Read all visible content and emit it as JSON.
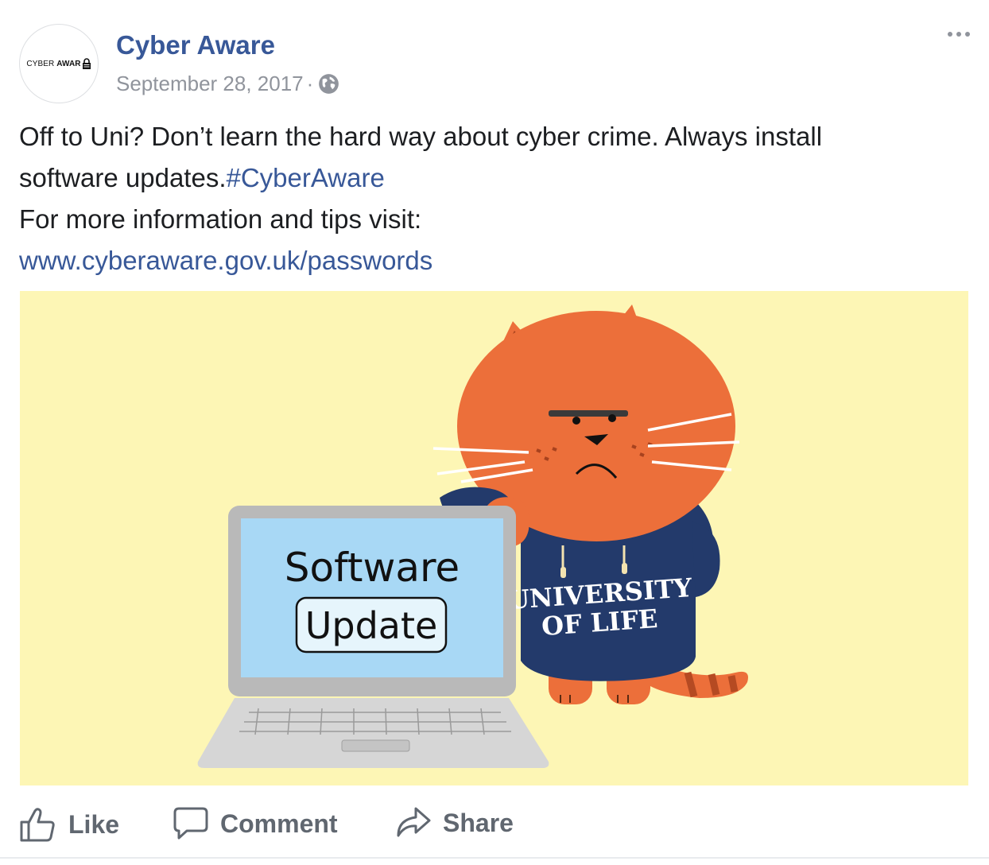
{
  "post": {
    "avatar_text_1": "CYBER",
    "avatar_text_2": "AWAR",
    "page_name": "Cyber Aware",
    "date": "September 28, 2017",
    "separator": "·",
    "privacy_icon": "globe-icon",
    "text_line1": "Off to Uni? Don’t learn the hard way about cyber crime. Always install",
    "text_line2_prefix": "software updates.",
    "hashtag": "#CyberAware",
    "text_line3": "For more information and tips visit:",
    "link": "www.cyberaware.gov.uk/passwords"
  },
  "image": {
    "screen_line1": "Software",
    "screen_line2": "Update",
    "hoodie_line1": "UNIVERSITY",
    "hoodie_line2": "OF LIFE",
    "background_color": "#fdf6b5",
    "cat_color": "#ec6f3a",
    "hoodie_color": "#233a6b",
    "screen_color": "#a8d8f5"
  },
  "actions": {
    "like": "Like",
    "comment": "Comment",
    "share": "Share"
  },
  "colors": {
    "link": "#385898",
    "meta": "#90949c",
    "action": "#606770"
  }
}
